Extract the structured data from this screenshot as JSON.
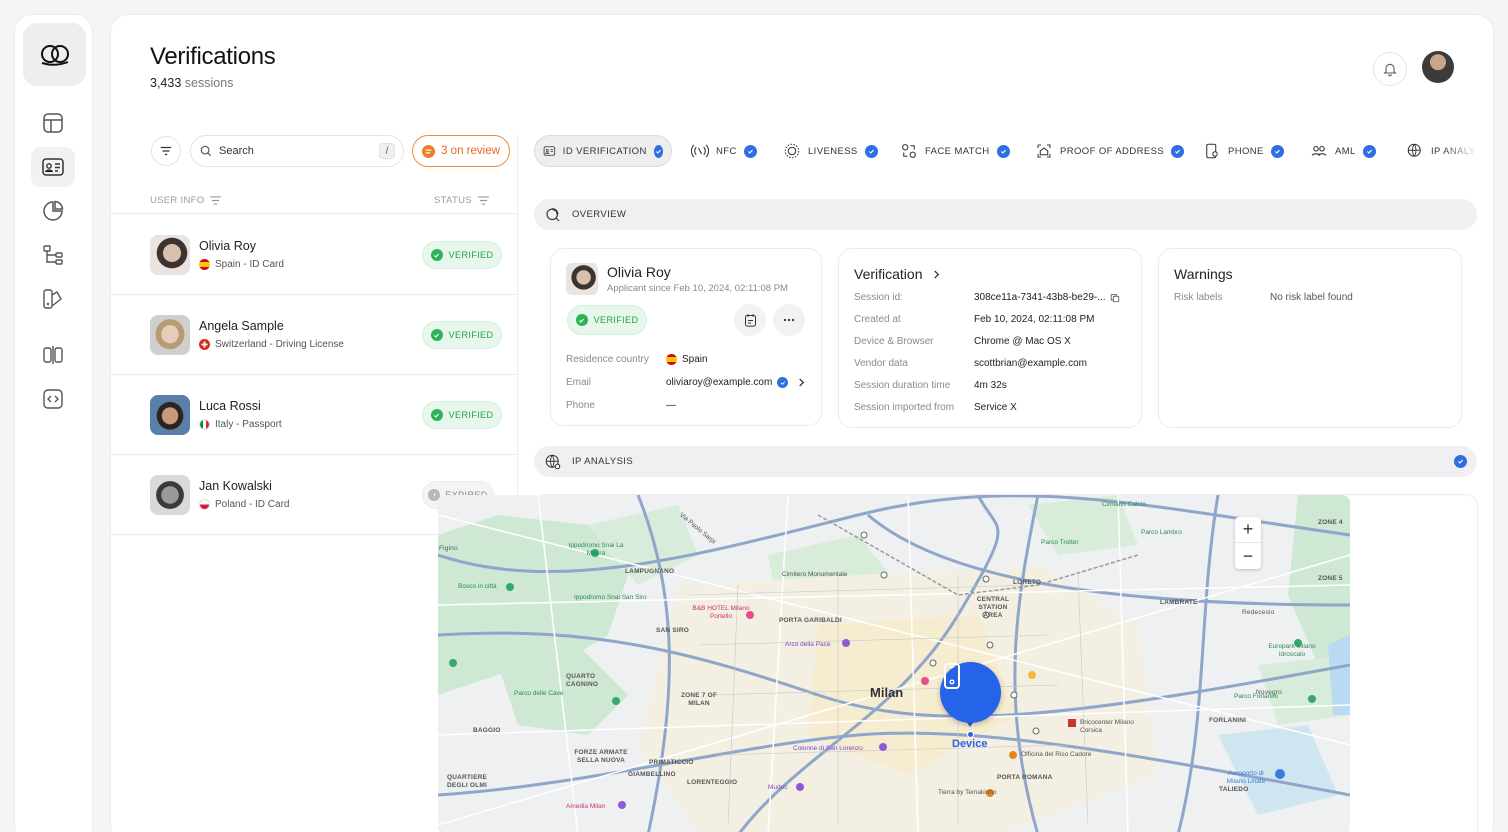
{
  "header": {
    "title": "Verifications",
    "session_count": "3,433",
    "session_word": "sessions"
  },
  "toolbar": {
    "search_placeholder": "Search",
    "search_shortcut": "/",
    "review_label": "3 on review"
  },
  "list": {
    "col_user": "USER INFO",
    "col_status": "STATUS",
    "rows": [
      {
        "name": "Olivia Roy",
        "country": "Spain",
        "doc": "ID Card",
        "meta": "Spain - ID Card",
        "status": "VERIFIED"
      },
      {
        "name": "Angela Sample",
        "country": "Switzerland",
        "doc": "Driving License",
        "meta": "Switzerland - Driving License",
        "status": "VERIFIED"
      },
      {
        "name": "Luca Rossi",
        "country": "Italy",
        "doc": "Passport",
        "meta": "Italy - Passport",
        "status": "VERIFIED"
      },
      {
        "name": "Jan Kowalski",
        "country": "Poland",
        "doc": "ID Card",
        "meta": "Poland - ID Card",
        "status": "EXPIRED"
      }
    ]
  },
  "tabs": [
    {
      "label": "ID VERIFICATION",
      "icon": "id-card-icon",
      "checked": true
    },
    {
      "label": "NFC",
      "icon": "nfc-icon",
      "checked": true
    },
    {
      "label": "LIVENESS",
      "icon": "liveness-icon",
      "checked": true
    },
    {
      "label": "FACE MATCH",
      "icon": "face-match-icon",
      "checked": true
    },
    {
      "label": "PROOF OF ADDRESS",
      "icon": "home-icon",
      "checked": true
    },
    {
      "label": "PHONE",
      "icon": "phone-icon",
      "checked": true
    },
    {
      "label": "AML",
      "icon": "aml-icon",
      "checked": true
    },
    {
      "label": "IP ANALYSIS",
      "icon": "globe-icon",
      "checked": false
    }
  ],
  "overview": {
    "section_label": "OVERVIEW",
    "applicant": {
      "name": "Olivia Roy",
      "since": "Applicant since Feb 10, 2024, 02:11:08 PM",
      "status": "VERIFIED",
      "residence_label": "Residence country",
      "residence_value": "Spain",
      "email_label": "Email",
      "email_value": "oliviaroy@example.com",
      "phone_label": "Phone",
      "phone_value": "—"
    },
    "verification": {
      "title": "Verification",
      "fields": [
        {
          "label": "Session id:",
          "value": "308ce11a-7341-43b8-be29-..."
        },
        {
          "label": "Created at",
          "value": "Feb 10, 2024, 02:11:08 PM"
        },
        {
          "label": "Device & Browser",
          "value": "Chrome @ Mac OS X"
        },
        {
          "label": "Vendor data",
          "value": "scottbrian@example.com"
        },
        {
          "label": "Session duration time",
          "value": "4m 32s"
        },
        {
          "label": "Session imported from",
          "value": "Service X"
        }
      ]
    },
    "warnings": {
      "title": "Warnings",
      "risk_label": "Risk labels",
      "risk_value": "No risk label found"
    }
  },
  "ip_analysis": {
    "section_label": "IP ANALYSIS",
    "map": {
      "city": "Milan",
      "device_label": "Device",
      "zoom_in": "+",
      "zoom_out": "−",
      "districts": [
        "LAMPUGNANO",
        "SAN SIRO",
        "QUARTO CAGNINO",
        "ZONE 7 OF MILAN",
        "BAGGIO",
        "FORZE ARMATE SELLA NUOVA",
        "PRIMATICCIO",
        "LORENTEGGIO",
        "GIAMBELLINO",
        "QUARTIERE DEGLI OLMI",
        "PORTA GARIBALDI",
        "CENTRAL STATION AREA",
        "LORETO",
        "LAMBRATE",
        "FORLANINI",
        "TALIEDO",
        "PORTA ROMANA",
        "ZONE 4",
        "ZONE 5",
        "Redecesio",
        "Novegro",
        "Figino"
      ],
      "pois": [
        "Ippodromo Snai La Maura",
        "Ippodromo Snai San Siro",
        "Parco delle Cave",
        "Bosco in città",
        "Cimitero Monumentale",
        "B&B HOTEL Milano Portello",
        "Arco della Pace",
        "Colonne di San Lorenzo",
        "Mudec",
        "Amedia Milan",
        "Officina del Riso Cadore",
        "Tierra by Temakinho",
        "Bricocenter Milano Corsica",
        "Parco Trotter",
        "Parco Lambro",
        "Cimiano Calcio",
        "Parco Forlanini",
        "Europark Milano Idroscalo",
        "Aeroporto di Milano Linate",
        "Via Paolo Sarpi"
      ]
    }
  },
  "colors": {
    "accent": "#2f6fe0",
    "verified": "#1fa24a",
    "review": "#e8672a",
    "device": "#2563e8"
  }
}
